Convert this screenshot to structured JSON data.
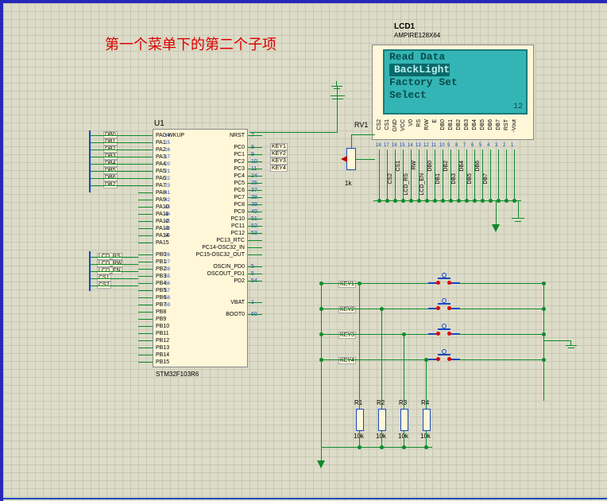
{
  "annotation": "第一个菜单下的第二个子项",
  "mcu": {
    "ref": "U1",
    "part": "STM32F103R6",
    "left_pins": [
      {
        "n": "14",
        "name": "PA0-WKUP"
      },
      {
        "n": "15",
        "name": "PA1"
      },
      {
        "n": "16",
        "name": "PA2"
      },
      {
        "n": "17",
        "name": "PA3"
      },
      {
        "n": "20",
        "name": "PA4"
      },
      {
        "n": "21",
        "name": "PA5"
      },
      {
        "n": "22",
        "name": "PA6"
      },
      {
        "n": "23",
        "name": "PA7"
      },
      {
        "n": "41",
        "name": "PA8"
      },
      {
        "n": "42",
        "name": "PA9"
      },
      {
        "n": "43",
        "name": "PA10"
      },
      {
        "n": "44",
        "name": "PA11"
      },
      {
        "n": "45",
        "name": "PA12"
      },
      {
        "n": "49",
        "name": "PA13"
      },
      {
        "n": "50",
        "name": "PA14"
      },
      {
        "n": "",
        "name": "PA15"
      },
      {
        "n": "",
        "name": ""
      },
      {
        "n": "26",
        "name": "PB0"
      },
      {
        "n": "27",
        "name": "PB1"
      },
      {
        "n": "28",
        "name": "PB2"
      },
      {
        "n": "55",
        "name": "PB3"
      },
      {
        "n": "56",
        "name": "PB4"
      },
      {
        "n": "57",
        "name": "PB5"
      },
      {
        "n": "58",
        "name": "PB6"
      },
      {
        "n": "59",
        "name": "PB7"
      },
      {
        "n": "",
        "name": "PB8"
      },
      {
        "n": "",
        "name": "PB9"
      },
      {
        "n": "",
        "name": "PB10"
      },
      {
        "n": "",
        "name": "PB11"
      },
      {
        "n": "",
        "name": "PB12"
      },
      {
        "n": "",
        "name": "PB13"
      },
      {
        "n": "",
        "name": "PB14"
      },
      {
        "n": "",
        "name": "PB15"
      }
    ],
    "right_pins": [
      {
        "n": "7",
        "name": "NRST"
      },
      {
        "n": "",
        "name": ""
      },
      {
        "n": "8",
        "name": "PC0"
      },
      {
        "n": "9",
        "name": "PC1"
      },
      {
        "n": "10",
        "name": "PC2"
      },
      {
        "n": "11",
        "name": "PC3"
      },
      {
        "n": "24",
        "name": "PC4"
      },
      {
        "n": "25",
        "name": "PC5"
      },
      {
        "n": "37",
        "name": "PC6"
      },
      {
        "n": "38",
        "name": "PC7"
      },
      {
        "n": "39",
        "name": "PC8"
      },
      {
        "n": "40",
        "name": "PC9"
      },
      {
        "n": "51",
        "name": "PC10"
      },
      {
        "n": "52",
        "name": "PC11"
      },
      {
        "n": "53",
        "name": "PC12"
      },
      {
        "n": "",
        "name": "PC13_RTC"
      },
      {
        "n": "",
        "name": "PC14-OSC32_IN"
      },
      {
        "n": "",
        "name": "PC15-OSC32_OUT"
      },
      {
        "n": "",
        "name": ""
      },
      {
        "n": "5",
        "name": "OSCIN_PD0"
      },
      {
        "n": "5",
        "name": "OSCOUT_PD1"
      },
      {
        "n": "54",
        "name": "PD2"
      },
      {
        "n": "",
        "name": ""
      },
      {
        "n": "",
        "name": ""
      },
      {
        "n": "",
        "name": ""
      },
      {
        "n": "1",
        "name": "VBAT"
      },
      {
        "n": "",
        "name": ""
      },
      {
        "n": "60",
        "name": "BOOT0"
      }
    ],
    "left_nets": [
      "DB0",
      "DB1",
      "DB2",
      "DB3",
      "DB4",
      "DB5",
      "DB6",
      "DB7"
    ],
    "left_nets_b": [
      "LCD_RS",
      "LCD_RW",
      "LCD_EN",
      "CS1",
      "CS2"
    ],
    "right_nets": [
      "KEY1",
      "KEY2",
      "KEY3",
      "KEY4"
    ]
  },
  "lcd": {
    "ref": "LCD1",
    "part": "AMPIRE128X64",
    "lines": [
      "Read Data",
      "BackLight",
      "Factory Set",
      "     Select"
    ],
    "selected_index": 1,
    "corner": "12",
    "pins": [
      "CS2",
      "CS1",
      "GND",
      "VCC",
      "V0",
      "RS",
      "R/W",
      "E",
      "DB0",
      "DB1",
      "DB2",
      "DB3",
      "DB4",
      "DB5",
      "DB6",
      "DB7",
      "RST",
      "-Vout"
    ],
    "pin_nums": [
      "18",
      "17",
      "16",
      "15",
      "14",
      "13",
      "12",
      "11",
      "10",
      "9",
      "8",
      "7",
      "6",
      "5",
      "4",
      "3",
      "2",
      "1"
    ],
    "net_labels": [
      "CS2",
      "LCD_RS",
      "LCD_EN",
      "DB1",
      "DB3",
      "DB5",
      "DB7"
    ],
    "net_labels2": [
      "CS1",
      "RW",
      "DB0",
      "DB2",
      "DB4",
      "DB6"
    ]
  },
  "pot": {
    "ref": "RV1",
    "val": "1k"
  },
  "buttons": [
    "KEY1",
    "KEY2",
    "KEY3",
    "KEY4"
  ],
  "resistors": [
    {
      "ref": "R1",
      "val": "10k"
    },
    {
      "ref": "R2",
      "val": "10k"
    },
    {
      "ref": "R3",
      "val": "10k"
    },
    {
      "ref": "R4",
      "val": "10k"
    }
  ]
}
